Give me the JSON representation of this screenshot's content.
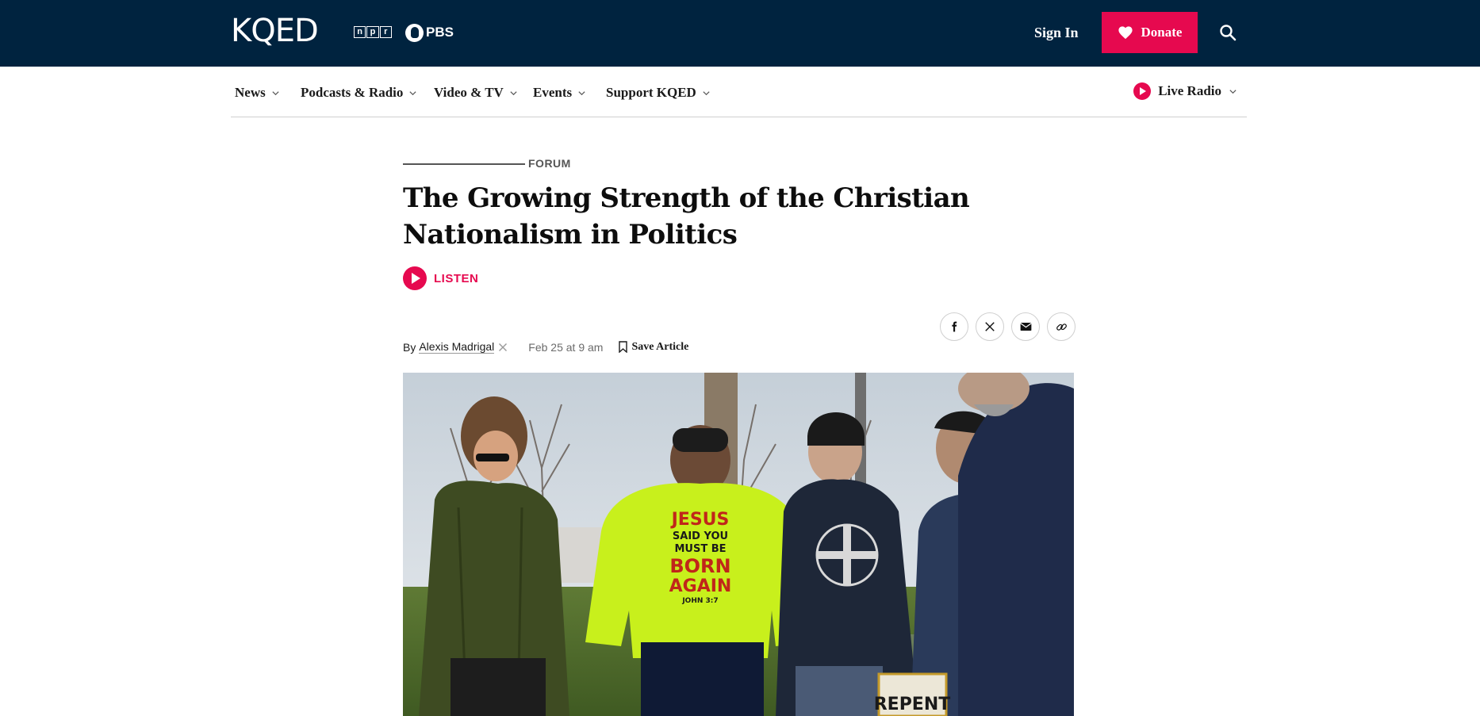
{
  "header": {
    "logo": "KQED",
    "npr_letters": [
      "n",
      "p",
      "r"
    ],
    "pbs": "PBS",
    "signin_label": "Sign In",
    "donate_label": "Donate",
    "search_icon": "search-icon"
  },
  "nav": {
    "items": [
      {
        "label": "News"
      },
      {
        "label": "Podcasts & Radio"
      },
      {
        "label": "Video & TV"
      },
      {
        "label": "Events"
      },
      {
        "label": "Support KQED"
      }
    ],
    "live_radio_label": "Live Radio"
  },
  "article": {
    "kicker": "FORUM",
    "headline_line1": "The Growing Strength of the Christian",
    "headline_line2": "Nationalism in Politics",
    "listen_label": "LISTEN",
    "by_prefix": "By",
    "author": "Alexis Madrigal",
    "date": "Feb 25 at 9 am",
    "save_label": "Save Article",
    "share_icons": [
      "facebook-icon",
      "x-icon",
      "email-icon",
      "link-icon"
    ]
  },
  "photo": {
    "sweatshirt_text": [
      "JESUS",
      "SAID YOU",
      "MUST BE",
      "BORN",
      "AGAIN",
      "JOHN 3:7"
    ],
    "sign_text": "REPENT"
  },
  "colors": {
    "header_bg": "#00233f",
    "accent": "#e6094f"
  }
}
